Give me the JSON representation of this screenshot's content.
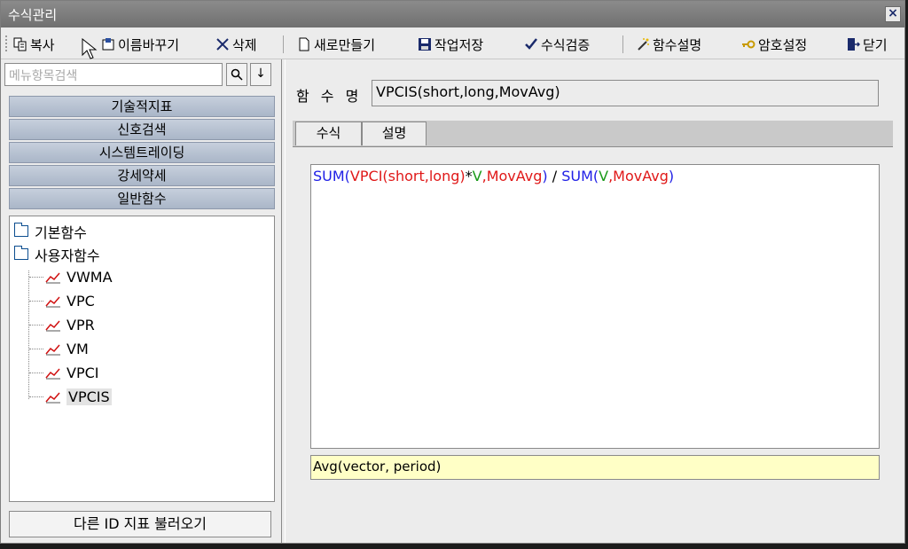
{
  "window": {
    "title": "수식관리",
    "close": "×"
  },
  "toolbar": {
    "copy": "복사",
    "rename": "이름바꾸기",
    "delete": "삭제",
    "new": "새로만들기",
    "save": "작업저장",
    "verify": "수식검증",
    "func_desc": "함수설명",
    "password": "암호설정",
    "close": "닫기"
  },
  "search": {
    "placeholder": "메뉴항목검색",
    "search_btn": "🔍",
    "down_btn": "↓"
  },
  "categories": [
    "기술적지표",
    "신호검색",
    "시스템트레이딩",
    "강세약세",
    "일반함수"
  ],
  "tree": {
    "folders": [
      "기본함수",
      "사용자함수"
    ],
    "items": [
      "VWMA",
      "VPC",
      "VPR",
      "VM",
      "VPCI",
      "VPCIS"
    ],
    "selected": "VPCIS"
  },
  "load_button": "다른 ID 지표 불러오기",
  "function_name": {
    "label": "함 수 명",
    "value": "VPCIS(short,long,MovAvg)"
  },
  "tabs": [
    "수식",
    "설명"
  ],
  "formula": [
    {
      "t": "SUM(",
      "c": "blue"
    },
    {
      "t": "VPCI(",
      "c": "red"
    },
    {
      "t": "short,long",
      "c": "red"
    },
    {
      "t": ")",
      "c": "red"
    },
    {
      "t": "*",
      "c": "black"
    },
    {
      "t": "V",
      "c": "green"
    },
    {
      "t": ",",
      "c": "red"
    },
    {
      "t": "MovAvg",
      "c": "red"
    },
    {
      "t": ")",
      "c": "blue"
    },
    {
      "t": " / ",
      "c": "black"
    },
    {
      "t": "SUM(",
      "c": "blue"
    },
    {
      "t": "V",
      "c": "green"
    },
    {
      "t": ",",
      "c": "red"
    },
    {
      "t": "MovAvg",
      "c": "red"
    },
    {
      "t": ")",
      "c": "blue"
    }
  ],
  "hint": "Avg(vector, period)"
}
